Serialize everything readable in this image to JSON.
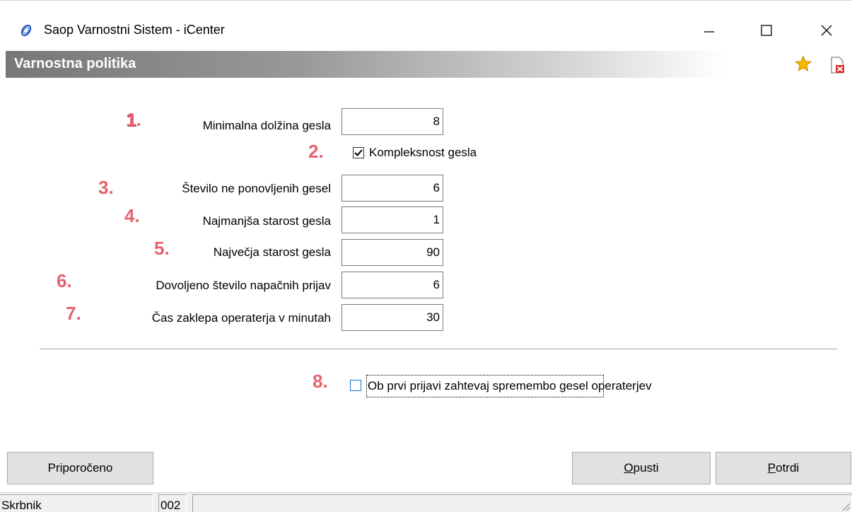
{
  "window": {
    "title": "Saop Varnostni Sistem - iCenter"
  },
  "header": {
    "title": "Varnostna politika"
  },
  "fields": [
    {
      "badge": "1.",
      "label": "Minimalna dolžina gesla",
      "value": "8"
    },
    {
      "badge": "3.",
      "label": "Število ne ponovljenih gesel",
      "value": "6"
    },
    {
      "badge": "4.",
      "label": "Najmanjša starost gesla",
      "value": "1"
    },
    {
      "badge": "5.",
      "label": "Največja starost gesla",
      "value": "90"
    },
    {
      "badge": "6.",
      "label": "Dovoljeno število napačnih prijav",
      "value": "6"
    },
    {
      "badge": "7.",
      "label": "Čas zaklepa operaterja v minutah",
      "value": "30"
    }
  ],
  "complexity": {
    "badge": "2.",
    "label": "Kompleksnost gesla",
    "checked": true
  },
  "first_login": {
    "badge": "8.",
    "label": "Ob prvi prijavi zahtevaj spremembo gesel operaterjev",
    "checked": false
  },
  "buttons": {
    "recommended": "Priporočeno",
    "cancel_first": "O",
    "cancel_rest": "pusti",
    "confirm_first": "P",
    "confirm_rest": "otrdi"
  },
  "status": {
    "user": "Skrbnik",
    "code": "002"
  },
  "colors": {
    "badge_fill": "#e8626e",
    "badge_shadow": "#b23a48",
    "checkbox_blue": "#1a73c9",
    "star": "#f5b800"
  }
}
